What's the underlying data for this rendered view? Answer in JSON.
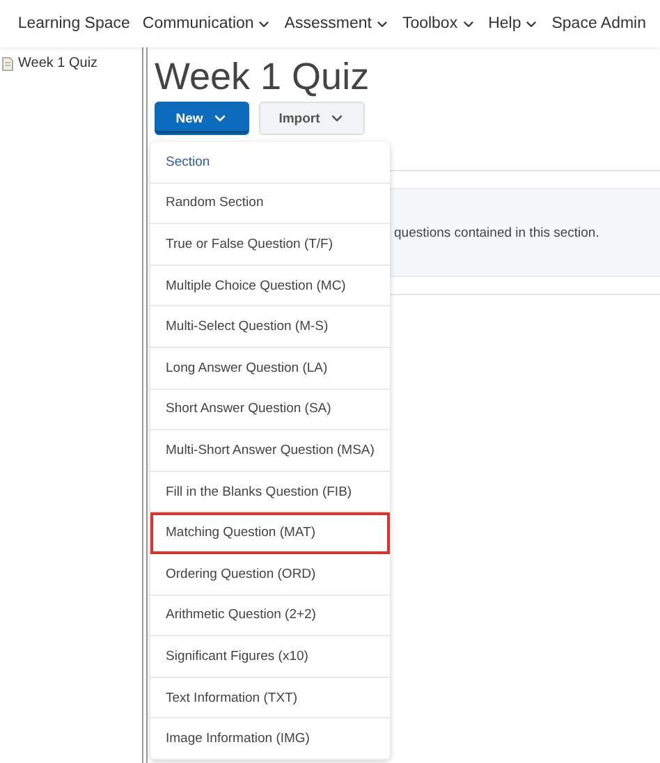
{
  "nav": [
    {
      "label": "Learning Space",
      "dropdown": false
    },
    {
      "label": "Communication",
      "dropdown": true
    },
    {
      "label": "Assessment",
      "dropdown": true
    },
    {
      "label": "Toolbox",
      "dropdown": true
    },
    {
      "label": "Help",
      "dropdown": true
    },
    {
      "label": "Space Admin",
      "dropdown": false
    }
  ],
  "sidebar": {
    "items": [
      {
        "label": "Week 1 Quiz"
      }
    ]
  },
  "title": "Week 1 Quiz",
  "buttons": [
    {
      "label": "New",
      "kind": "primary",
      "expanded": true
    },
    {
      "label": "Import",
      "kind": "secondary",
      "expanded": false
    }
  ],
  "panel_text": "questions contained in this section.",
  "menu": [
    {
      "label": "Section",
      "focused": true,
      "outlined": false
    },
    {
      "label": "Random Section",
      "focused": false,
      "outlined": false
    },
    {
      "label": "True or False Question (T/F)",
      "focused": false,
      "outlined": false
    },
    {
      "label": "Multiple Choice Question (MC)",
      "focused": false,
      "outlined": false
    },
    {
      "label": "Multi-Select Question (M-S)",
      "focused": false,
      "outlined": false
    },
    {
      "label": "Long Answer Question (LA)",
      "focused": false,
      "outlined": false
    },
    {
      "label": "Short Answer Question (SA)",
      "focused": false,
      "outlined": false
    },
    {
      "label": "Multi-Short Answer Question (MSA)",
      "focused": false,
      "outlined": false
    },
    {
      "label": "Fill in the Blanks Question (FIB)",
      "focused": false,
      "outlined": false
    },
    {
      "label": "Matching Question (MAT)",
      "focused": false,
      "outlined": true
    },
    {
      "label": "Ordering Question (ORD)",
      "focused": false,
      "outlined": false
    },
    {
      "label": "Arithmetic Question (2+2)",
      "focused": false,
      "outlined": false
    },
    {
      "label": "Significant Figures (x10)",
      "focused": false,
      "outlined": false
    },
    {
      "label": "Text Information (TXT)",
      "focused": false,
      "outlined": false
    },
    {
      "label": "Image Information (IMG)",
      "focused": false,
      "outlined": false
    }
  ]
}
